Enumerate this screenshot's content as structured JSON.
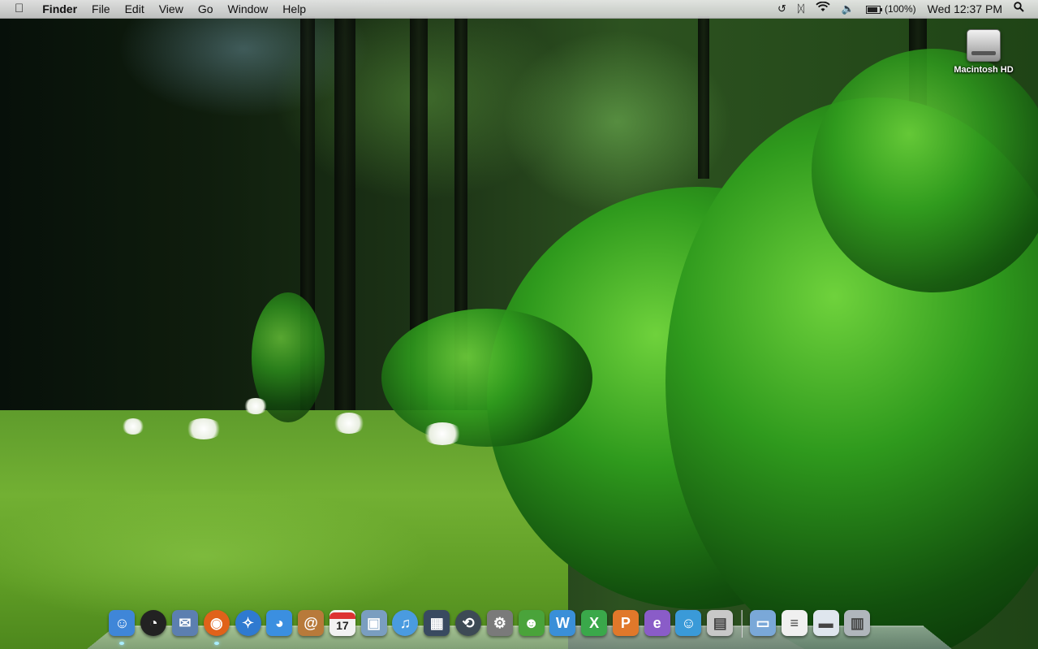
{
  "menubar": {
    "apple_icon": "apple-icon",
    "app_name": "Finder",
    "menus": [
      "File",
      "Edit",
      "View",
      "Go",
      "Window",
      "Help"
    ],
    "extras": {
      "time_machine_icon": "time-machine-icon",
      "bluetooth_icon": "bluetooth-icon",
      "wifi_icon": "wifi-icon",
      "volume_icon": "volume-icon",
      "battery_icon": "battery-icon",
      "battery_percent": "(100%)",
      "clock": "Wed 12:37 PM",
      "spotlight_icon": "spotlight-icon"
    }
  },
  "desktop": {
    "icons": [
      {
        "label": "Macintosh HD",
        "icon": "hard-drive-icon"
      }
    ]
  },
  "dock": {
    "apps": [
      {
        "name": "finder",
        "icon": "finder-icon",
        "color": "#3f86d8",
        "running": true
      },
      {
        "name": "dashboard",
        "icon": "dashboard-icon",
        "color": "#222222",
        "running": false
      },
      {
        "name": "mail",
        "icon": "mail-icon",
        "color": "#5c7fb0",
        "running": false
      },
      {
        "name": "firefox",
        "icon": "firefox-icon",
        "color": "#e0621a",
        "running": true
      },
      {
        "name": "safari",
        "icon": "safari-icon",
        "color": "#2f7ad0",
        "running": false
      },
      {
        "name": "ichat",
        "icon": "ichat-icon",
        "color": "#3b8fe0",
        "running": false
      },
      {
        "name": "address-book",
        "icon": "address-book-icon",
        "color": "#b87a3a",
        "running": false
      },
      {
        "name": "ical",
        "icon": "calendar-icon",
        "color": "#f2f2f2",
        "running": false,
        "text": "17"
      },
      {
        "name": "iphoto",
        "icon": "iphoto-icon",
        "color": "#7a9ec0",
        "running": false
      },
      {
        "name": "itunes",
        "icon": "itunes-icon",
        "color": "#4a9be0",
        "running": false
      },
      {
        "name": "spaces",
        "icon": "spaces-icon",
        "color": "#394a60",
        "running": false
      },
      {
        "name": "time-machine",
        "icon": "time-machine-dock-icon",
        "color": "#3d4a55",
        "running": false
      },
      {
        "name": "system-preferences",
        "icon": "system-preferences-icon",
        "color": "#7a7a7a",
        "running": false
      },
      {
        "name": "adium",
        "icon": "adium-icon",
        "color": "#4aa33a",
        "running": false
      },
      {
        "name": "word",
        "icon": "word-icon",
        "color": "#3a8fd8",
        "running": false
      },
      {
        "name": "excel",
        "icon": "excel-icon",
        "color": "#3aa84a",
        "running": false
      },
      {
        "name": "powerpoint",
        "icon": "powerpoint-icon",
        "color": "#e0782a",
        "running": false
      },
      {
        "name": "entourage",
        "icon": "entourage-icon",
        "color": "#8a5cc8",
        "running": false
      },
      {
        "name": "messenger",
        "icon": "messenger-icon",
        "color": "#3a9ad8",
        "running": false
      },
      {
        "name": "image-viewer",
        "icon": "image-viewer-icon",
        "color": "#c8c8c8",
        "running": false
      }
    ],
    "stacks": [
      {
        "name": "applications-folder",
        "icon": "folder-icon",
        "color": "#7aa8d8"
      },
      {
        "name": "pdf-document",
        "icon": "pdf-document-icon",
        "color": "#f0f0f0"
      },
      {
        "name": "downloads",
        "icon": "downloads-icon",
        "color": "#dfe6ee"
      },
      {
        "name": "trash",
        "icon": "trash-icon",
        "color": "#b0b6bc"
      }
    ]
  }
}
